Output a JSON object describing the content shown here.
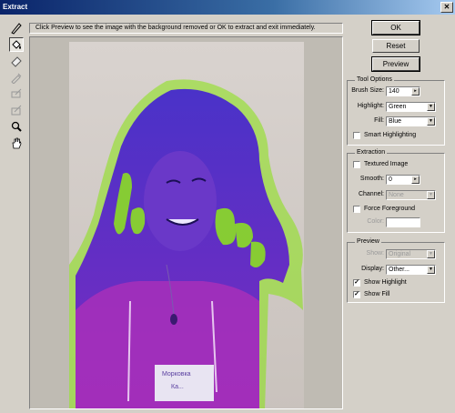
{
  "window": {
    "title": "Extract",
    "close_glyph": "✕"
  },
  "hint": "Click Preview to see the image with the background removed or OK to extract and exit immediately.",
  "tools": [
    "edge-highlighter-icon",
    "fill-icon",
    "eraser-icon",
    "eyedropper-icon",
    "cleanup-icon",
    "edge-touchup-icon",
    "zoom-icon",
    "hand-icon"
  ],
  "buttons": {
    "ok": "OK",
    "reset": "Reset",
    "preview": "Preview"
  },
  "tool_options": {
    "title": "Tool Options",
    "brush_size_label": "Brush Size:",
    "brush_size": "140",
    "brush_arrow": "▸",
    "highlight_label": "Highlight:",
    "highlight": "Green",
    "fill_label": "Fill:",
    "fill": "Blue",
    "smart_highlighting": "Smart Highlighting"
  },
  "extraction": {
    "title": "Extraction",
    "textured_image": "Textured Image",
    "smooth_label": "Smooth:",
    "smooth": "0",
    "channel_label": "Channel:",
    "channel": "None",
    "force_foreground": "Force Foreground",
    "color_label": "Color:"
  },
  "preview": {
    "title": "Preview",
    "show_label": "Show:",
    "show": "Original",
    "display_label": "Display:",
    "display": "Other...",
    "show_highlight": "Show Highlight",
    "show_fill": "Show Fill",
    "check_glyph": "✓"
  },
  "image_text": {
    "line1": "Морковка",
    "line2": "Ка..."
  },
  "colors": {
    "highlight": "#7ee00a",
    "fill": "#5a2ed0",
    "title_bar": "#0a246a"
  }
}
